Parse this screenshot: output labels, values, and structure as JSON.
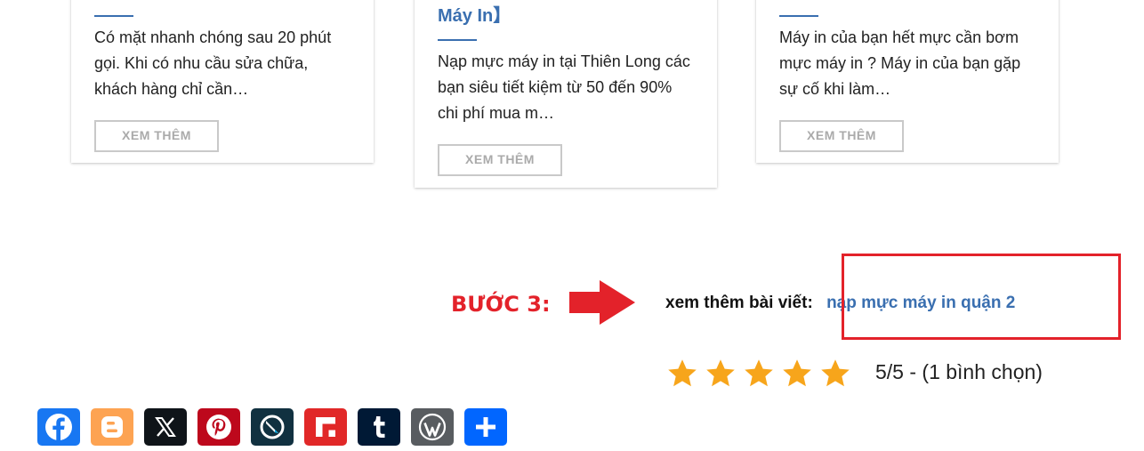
{
  "cards": [
    {
      "title": "",
      "text": "Có mặt nhanh chóng sau 20 phút gọi. Khi có nhu cầu sửa chữa, khách hàng chỉ cần…",
      "button": "XEM THÊM"
    },
    {
      "title": "Máy In】",
      "text": "Nạp mực máy in tại Thiên Long các bạn siêu tiết kiệm từ 50 đến 90% chi phí mua m…",
      "button": "XEM THÊM"
    },
    {
      "title": "",
      "text": "Máy in của bạn hết mực cần bơm mực máy in ? Máy in của bạn gặp sự cố khi làm…",
      "button": "XEM THÊM"
    }
  ],
  "annotation": {
    "step_label": "BƯỚC 3:",
    "color": "#e3222a"
  },
  "related": {
    "label": "xem thêm bài viết:",
    "link_text": "nạp mực máy in quận 2"
  },
  "rating": {
    "stars": 5,
    "max": 5,
    "text": "5/5 - (1 bình chọn)",
    "star_color": "#f7a51b"
  },
  "share_buttons": [
    {
      "icon": "facebook-icon",
      "color": "#1877f2"
    },
    {
      "icon": "blogger-icon",
      "color": "#fda352"
    },
    {
      "icon": "x-icon",
      "color": "#0f1419"
    },
    {
      "icon": "pinterest-icon",
      "color": "#bd081c"
    },
    {
      "icon": "livejournal-icon",
      "color": "#113140"
    },
    {
      "icon": "flipboard-icon",
      "color": "#e12828"
    },
    {
      "icon": "tumblr-icon",
      "color": "#001935"
    },
    {
      "icon": "wordpress-icon",
      "color": "#585c60"
    },
    {
      "icon": "share-icon",
      "color": "#0166ff"
    }
  ],
  "accent_color": "#3a6fb0"
}
